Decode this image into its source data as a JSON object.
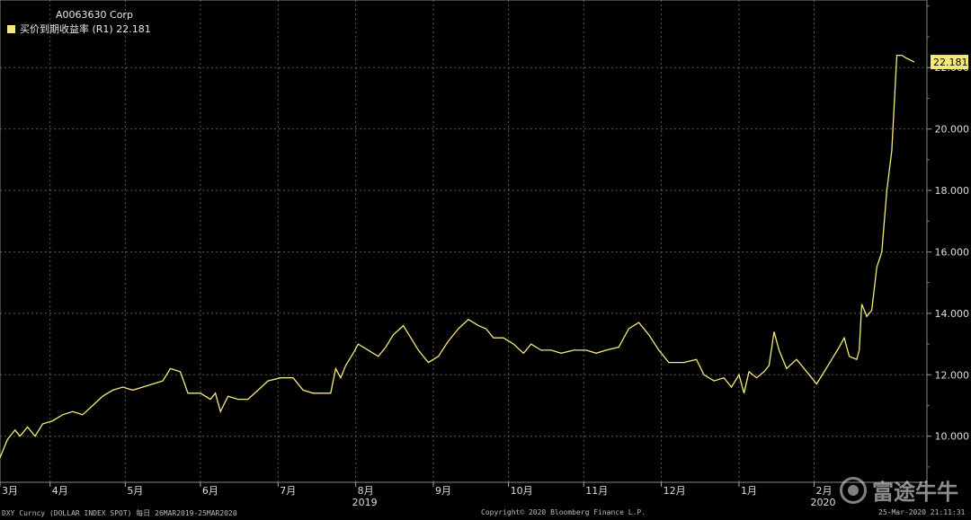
{
  "legend": {
    "security": "A0063630 Corp",
    "series_label": "买价到期收益率 (R1) 22.181"
  },
  "footer": {
    "left": "DXY Curncy (DOLLAR INDEX SPOT)  每日 26MAR2019-25MAR2020",
    "center": "Copyright© 2020 Bloomberg Finance L.P.",
    "right": "25-Mar-2020 21:11:31"
  },
  "watermark": {
    "text": "富途牛牛",
    "logo": "futu-logo-icon"
  },
  "colors": {
    "background": "#000000",
    "series": "#f5e97a",
    "grid": "#5a5a5a",
    "last_badge": "#f5e97a"
  },
  "chart_data": {
    "type": "line",
    "yaxis_side": "right",
    "ylim": [
      8.5,
      24.2
    ],
    "yticks": [
      "10.000",
      "12.000",
      "14.000",
      "16.000",
      "18.000",
      "20.000",
      "22.000"
    ],
    "ytick_values": [
      10,
      12,
      14,
      16,
      18,
      20,
      22
    ],
    "grid": true,
    "x_start": "2019-03-26",
    "x_end": "2020-03-25",
    "xticks": [
      {
        "date": "2019-03-26",
        "label": "3月"
      },
      {
        "date": "2019-04-15",
        "label": "4月"
      },
      {
        "date": "2019-05-15",
        "label": "5月"
      },
      {
        "date": "2019-06-14",
        "label": "6月"
      },
      {
        "date": "2019-07-15",
        "label": "7月"
      },
      {
        "date": "2019-08-15",
        "label": "8月"
      },
      {
        "date": "2019-09-15",
        "label": "9月"
      },
      {
        "date": "2019-10-15",
        "label": "10月"
      },
      {
        "date": "2019-11-14",
        "label": "11月"
      },
      {
        "date": "2019-12-15",
        "label": "12月"
      },
      {
        "date": "2020-01-15",
        "label": "1月"
      },
      {
        "date": "2020-02-14",
        "label": "2月"
      }
    ],
    "year_labels": [
      {
        "date": "2019-08-15",
        "label": "2019"
      },
      {
        "date": "2020-02-14",
        "label": "2020"
      }
    ],
    "last_value": "22.181",
    "series": [
      {
        "name": "买价到期收益率 (R1)",
        "points": [
          [
            "2019-03-26",
            9.3
          ],
          [
            "2019-03-29",
            9.9
          ],
          [
            "2019-04-01",
            10.2
          ],
          [
            "2019-04-03",
            10.0
          ],
          [
            "2019-04-06",
            10.3
          ],
          [
            "2019-04-09",
            10.0
          ],
          [
            "2019-04-12",
            10.4
          ],
          [
            "2019-04-16",
            10.5
          ],
          [
            "2019-04-20",
            10.7
          ],
          [
            "2019-04-24",
            10.8
          ],
          [
            "2019-04-28",
            10.7
          ],
          [
            "2019-05-02",
            11.0
          ],
          [
            "2019-05-06",
            11.3
          ],
          [
            "2019-05-10",
            11.5
          ],
          [
            "2019-05-14",
            11.6
          ],
          [
            "2019-05-18",
            11.5
          ],
          [
            "2019-05-22",
            11.6
          ],
          [
            "2019-05-26",
            11.7
          ],
          [
            "2019-05-30",
            11.8
          ],
          [
            "2019-06-02",
            12.2
          ],
          [
            "2019-06-06",
            12.1
          ],
          [
            "2019-06-09",
            11.4
          ],
          [
            "2019-06-14",
            11.4
          ],
          [
            "2019-06-18",
            11.2
          ],
          [
            "2019-06-20",
            11.4
          ],
          [
            "2019-06-22",
            10.8
          ],
          [
            "2019-06-25",
            11.3
          ],
          [
            "2019-06-29",
            11.2
          ],
          [
            "2019-07-03",
            11.2
          ],
          [
            "2019-07-07",
            11.5
          ],
          [
            "2019-07-11",
            11.8
          ],
          [
            "2019-07-16",
            11.9
          ],
          [
            "2019-07-21",
            11.9
          ],
          [
            "2019-07-25",
            11.5
          ],
          [
            "2019-07-29",
            11.4
          ],
          [
            "2019-08-02",
            11.4
          ],
          [
            "2019-08-05",
            11.4
          ],
          [
            "2019-08-07",
            12.2
          ],
          [
            "2019-08-09",
            11.9
          ],
          [
            "2019-08-11",
            12.3
          ],
          [
            "2019-08-14",
            12.7
          ],
          [
            "2019-08-16",
            13.0
          ],
          [
            "2019-08-20",
            12.8
          ],
          [
            "2019-08-24",
            12.6
          ],
          [
            "2019-08-27",
            12.9
          ],
          [
            "2019-08-30",
            13.3
          ],
          [
            "2019-09-03",
            13.6
          ],
          [
            "2019-09-06",
            13.2
          ],
          [
            "2019-09-09",
            12.8
          ],
          [
            "2019-09-13",
            12.4
          ],
          [
            "2019-09-17",
            12.6
          ],
          [
            "2019-09-21",
            13.1
          ],
          [
            "2019-09-25",
            13.5
          ],
          [
            "2019-09-29",
            13.8
          ],
          [
            "2019-10-03",
            13.6
          ],
          [
            "2019-10-06",
            13.5
          ],
          [
            "2019-10-09",
            13.2
          ],
          [
            "2019-10-13",
            13.2
          ],
          [
            "2019-10-17",
            13.0
          ],
          [
            "2019-10-21",
            12.7
          ],
          [
            "2019-10-24",
            13.0
          ],
          [
            "2019-10-28",
            12.8
          ],
          [
            "2019-11-01",
            12.8
          ],
          [
            "2019-11-05",
            12.7
          ],
          [
            "2019-11-10",
            12.8
          ],
          [
            "2019-11-15",
            12.8
          ],
          [
            "2019-11-19",
            12.7
          ],
          [
            "2019-11-23",
            12.8
          ],
          [
            "2019-11-28",
            12.9
          ],
          [
            "2019-12-02",
            13.5
          ],
          [
            "2019-12-06",
            13.7
          ],
          [
            "2019-12-10",
            13.3
          ],
          [
            "2019-12-14",
            12.8
          ],
          [
            "2019-12-18",
            12.4
          ],
          [
            "2019-12-24",
            12.4
          ],
          [
            "2019-12-29",
            12.5
          ],
          [
            "2020-01-01",
            12.0
          ],
          [
            "2020-01-05",
            11.8
          ],
          [
            "2020-01-09",
            11.9
          ],
          [
            "2020-01-12",
            11.6
          ],
          [
            "2020-01-15",
            12.0
          ],
          [
            "2020-01-17",
            11.4
          ],
          [
            "2020-01-19",
            12.1
          ],
          [
            "2020-01-22",
            11.9
          ],
          [
            "2020-01-25",
            12.1
          ],
          [
            "2020-01-27",
            12.3
          ],
          [
            "2020-01-29",
            13.4
          ],
          [
            "2020-01-31",
            12.8
          ],
          [
            "2020-02-03",
            12.2
          ],
          [
            "2020-02-07",
            12.5
          ],
          [
            "2020-02-10",
            12.2
          ],
          [
            "2020-02-12",
            12.0
          ],
          [
            "2020-02-15",
            11.7
          ],
          [
            "2020-02-18",
            12.1
          ],
          [
            "2020-02-21",
            12.5
          ],
          [
            "2020-02-24",
            12.9
          ],
          [
            "2020-02-26",
            13.2
          ],
          [
            "2020-02-28",
            12.6
          ],
          [
            "2020-03-02",
            12.5
          ],
          [
            "2020-03-03",
            12.8
          ],
          [
            "2020-03-04",
            14.3
          ],
          [
            "2020-03-06",
            13.9
          ],
          [
            "2020-03-08",
            14.1
          ],
          [
            "2020-03-10",
            15.5
          ],
          [
            "2020-03-12",
            16.0
          ],
          [
            "2020-03-14",
            18.0
          ],
          [
            "2020-03-16",
            19.3
          ],
          [
            "2020-03-18",
            22.4
          ],
          [
            "2020-03-20",
            22.4
          ],
          [
            "2020-03-22",
            22.3
          ],
          [
            "2020-03-25",
            22.181
          ]
        ]
      }
    ]
  }
}
